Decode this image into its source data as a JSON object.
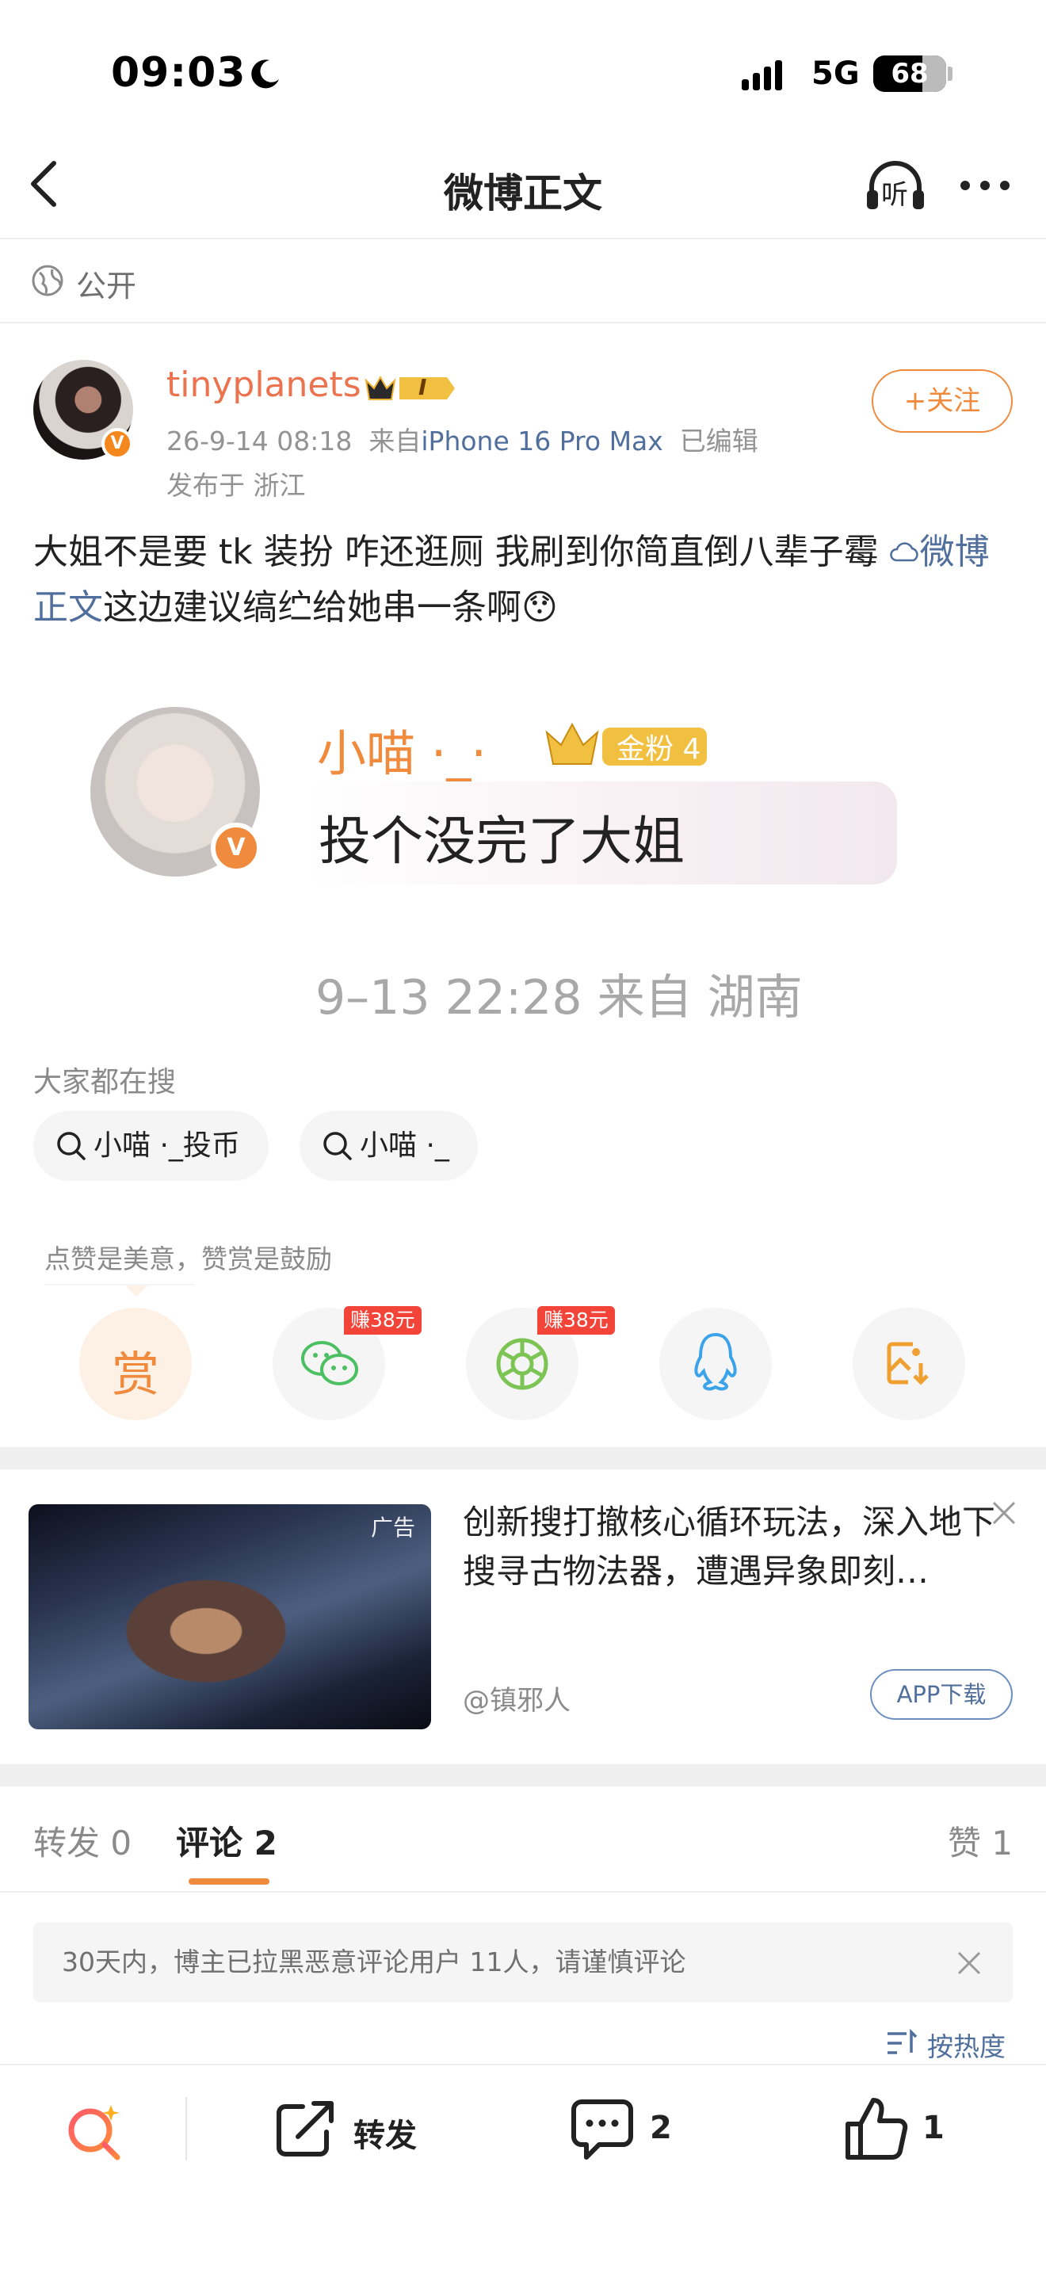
{
  "status_bar": {
    "time": "09:03",
    "network": "5G",
    "battery": "68"
  },
  "nav": {
    "title": "微博正文",
    "listen_label": "听"
  },
  "visibility": "公开",
  "post": {
    "username": "tinyplanets",
    "level": "I",
    "verified_badge": "V",
    "time": "26-9-14 08:18",
    "from_prefix": "来自",
    "device": "iPhone 16 Pro Max",
    "edited": "已编辑",
    "location": "发布于 浙江",
    "follow_label": "+关注",
    "text_before": "大姐不是要 tk 装扮 咋还逛厕 我刷到你简直倒八辈子霉 ",
    "link_text": "微博正文",
    "text_after": "这边建议缟纻给她串一条啊",
    "emoji": "😯"
  },
  "embedded_image": {
    "commenter": "小喵 ·_·",
    "fan_badge": "金粉 4",
    "verified_badge": "V",
    "comment": "投个没完了大姐",
    "time_loc": "9–13 22:28  来自 湖南"
  },
  "hot_search": {
    "title": "大家都在搜",
    "items": [
      "小喵 ·_投币",
      "小喵 ·_"
    ]
  },
  "reward": {
    "tip": "点赞是美意，赞赏是鼓励",
    "reward_label": "赏",
    "earn_tag_1": "赚38元",
    "earn_tag_2": "赚38元"
  },
  "ad": {
    "tag": "广告",
    "text": "创新搜打撤核心循环玩法，深入地下搜寻古物法器，遭遇异象即刻…",
    "source": "@镇邪人",
    "button": "APP下载"
  },
  "tabs": {
    "repost": "转发 0",
    "comment": "评论 2",
    "like": "赞 1"
  },
  "notice": "30天内，博主已拉黑恶意评论用户 11人，请谨慎评论",
  "sort_label": "按热度",
  "bottom_bar": {
    "repost_label": "转发",
    "comment_count": "2",
    "like_count": "1"
  },
  "colors": {
    "accent_orange": "#f08a3c",
    "username_orange": "#eb7350",
    "link_blue": "#506f9c",
    "earn_red": "#f24438"
  }
}
